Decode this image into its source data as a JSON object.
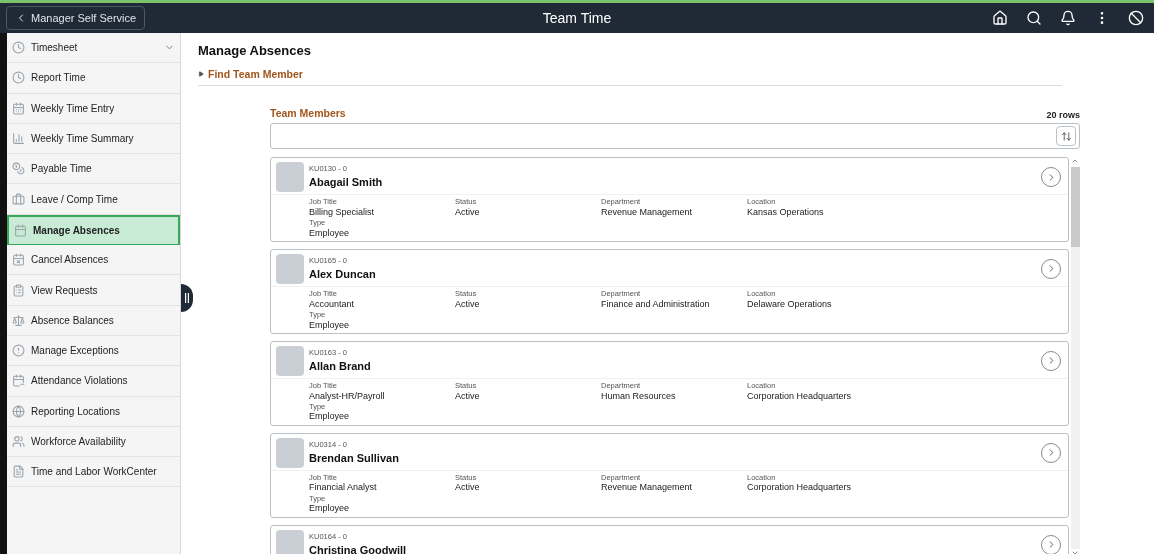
{
  "header": {
    "back_button": "Manager Self Service",
    "title": "Team Time"
  },
  "sidebar": {
    "items": [
      {
        "label": "Timesheet",
        "selected": false,
        "expandable": true
      },
      {
        "label": "Report Time",
        "selected": false,
        "expandable": false
      },
      {
        "label": "Weekly Time Entry",
        "selected": false,
        "expandable": false
      },
      {
        "label": "Weekly Time Summary",
        "selected": false,
        "expandable": false
      },
      {
        "label": "Payable Time",
        "selected": false,
        "expandable": false
      },
      {
        "label": "Leave / Comp Time",
        "selected": false,
        "expandable": false
      },
      {
        "label": "Manage Absences",
        "selected": true,
        "expandable": false
      },
      {
        "label": "Cancel Absences",
        "selected": false,
        "expandable": false
      },
      {
        "label": "View Requests",
        "selected": false,
        "expandable": false
      },
      {
        "label": "Absence Balances",
        "selected": false,
        "expandable": false
      },
      {
        "label": "Manage Exceptions",
        "selected": false,
        "expandable": false
      },
      {
        "label": "Attendance Violations",
        "selected": false,
        "expandable": false
      },
      {
        "label": "Reporting Locations",
        "selected": false,
        "expandable": false
      },
      {
        "label": "Workforce Availability",
        "selected": false,
        "expandable": false
      },
      {
        "label": "Time and Labor WorkCenter",
        "selected": false,
        "expandable": false
      }
    ]
  },
  "page": {
    "title": "Manage Absences",
    "find_section": {
      "label": "Find Team Member",
      "expanded": false
    }
  },
  "team_members": {
    "title": "Team Members",
    "row_count": "20 rows",
    "members": [
      {
        "id": "KU0130 - 0",
        "name": "Abagail Smith",
        "fields": [
          {
            "label": "Job Title",
            "value": "Billing Specialist"
          },
          {
            "label": "Status",
            "value": "Active"
          },
          {
            "label": "Department",
            "value": "Revenue Management"
          },
          {
            "label": "Location",
            "value": "Kansas Operations"
          },
          {
            "label": "Type",
            "value": "Employee"
          }
        ]
      },
      {
        "id": "KU0165 - 0",
        "name": "Alex Duncan",
        "fields": [
          {
            "label": "Job Title",
            "value": "Accountant"
          },
          {
            "label": "Status",
            "value": "Active"
          },
          {
            "label": "Department",
            "value": "Finance and Administration"
          },
          {
            "label": "Location",
            "value": "Delaware Operations"
          },
          {
            "label": "Type",
            "value": "Employee"
          }
        ]
      },
      {
        "id": "KU0163 - 0",
        "name": "Allan Brand",
        "fields": [
          {
            "label": "Job Title",
            "value": "Analyst-HR/Payroll"
          },
          {
            "label": "Status",
            "value": "Active"
          },
          {
            "label": "Department",
            "value": "Human Resources"
          },
          {
            "label": "Location",
            "value": "Corporation Headquarters"
          },
          {
            "label": "Type",
            "value": "Employee"
          }
        ]
      },
      {
        "id": "KU0314 - 0",
        "name": "Brendan Sullivan",
        "fields": [
          {
            "label": "Job Title",
            "value": "Financial Analyst"
          },
          {
            "label": "Status",
            "value": "Active"
          },
          {
            "label": "Department",
            "value": "Revenue Management"
          },
          {
            "label": "Location",
            "value": "Corporation Headquarters"
          },
          {
            "label": "Type",
            "value": "Employee"
          }
        ]
      },
      {
        "id": "KU0164 - 0",
        "name": "Christina Goodwill"
      }
    ]
  }
}
